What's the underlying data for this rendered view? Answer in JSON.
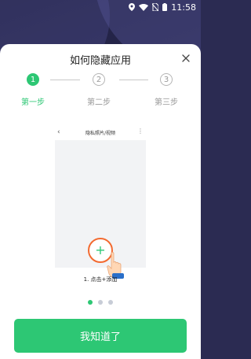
{
  "statusbar": {
    "time": "11:58",
    "icons": [
      "location-icon",
      "wifi-icon",
      "no-sim-icon",
      "battery-icon"
    ]
  },
  "dialog": {
    "title": "如何隐藏应用",
    "close_icon": "close-icon",
    "steps": [
      {
        "number": "1",
        "label": "第一步",
        "state": "active"
      },
      {
        "number": "2",
        "label": "第二步",
        "state": "inactive"
      },
      {
        "number": "3",
        "label": "第三步",
        "state": "inactive"
      }
    ],
    "preview": {
      "title": "隐私照片/视频",
      "add_symbol": "+"
    },
    "caption": "1. 点击+添加",
    "pagination": {
      "count": 3,
      "active_index": 0
    },
    "confirm_button": "我知道了"
  },
  "colors": {
    "accent": "#2dc774",
    "add_ring": "#f36a30",
    "inactive": "#999999"
  }
}
